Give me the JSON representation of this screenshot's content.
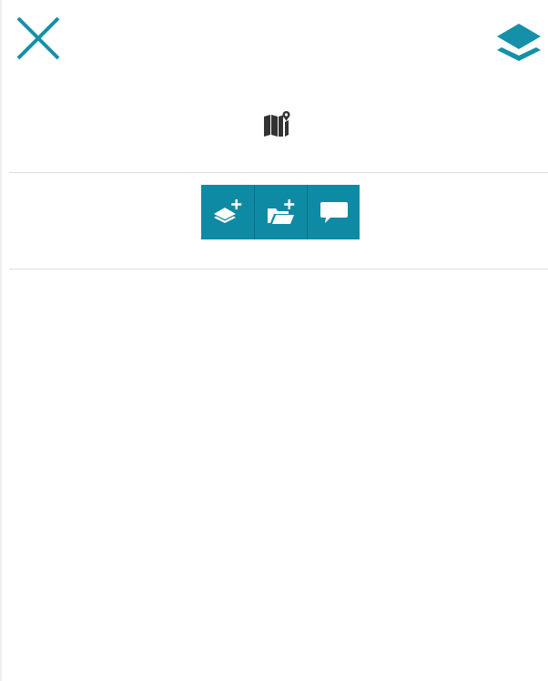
{
  "header": {
    "close_icon": "close-icon",
    "layers_icon": "layers-icon"
  },
  "map_section": {
    "icon": "map-marker-icon"
  },
  "toolbar": {
    "buttons": [
      {
        "icon": "add-layer-icon"
      },
      {
        "icon": "add-folder-icon"
      },
      {
        "icon": "comment-icon"
      }
    ]
  },
  "colors": {
    "accent": "#1490a8",
    "toolbar_bg": "#0f8aa4",
    "map_icon": "#333333",
    "divider": "#dddddd"
  }
}
